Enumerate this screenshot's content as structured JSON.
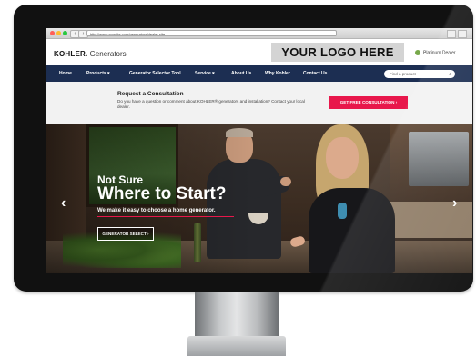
{
  "browser": {
    "url": "http://www.yoursite.com/generators/dealer-site",
    "back_label": "‹",
    "forward_label": "›"
  },
  "header": {
    "brand_bold": "KOHLER.",
    "brand_text": " Generators",
    "logo_placeholder": "YOUR LOGO HERE",
    "dealer_label": "Platinum Dealer"
  },
  "nav": {
    "items": [
      "Home",
      "Products ▾",
      "Generator Selector Tool",
      "Service ▾",
      "About Us",
      "Why Kohler",
      "Contact Us"
    ],
    "search_placeholder": "Find a product",
    "search_icon": "⌕"
  },
  "consultation": {
    "title": "Request a Consultation",
    "text": "Do you have a question or comment about KOHLER® generators and installation? Contact your local dealer.",
    "button": "GET FREE CONSULTATION ›"
  },
  "hero": {
    "kicker": "Not Sure",
    "title": "Where to Start?",
    "subtitle": "We make it easy to choose a home generator.",
    "button": "GENERATOR SELECT ›",
    "prev_arrow": "‹",
    "next_arrow": "›"
  },
  "colors": {
    "nav_bg": "#1c2e52",
    "cta_accent": "#e8174b",
    "dealer_badge": "#77a84a"
  }
}
